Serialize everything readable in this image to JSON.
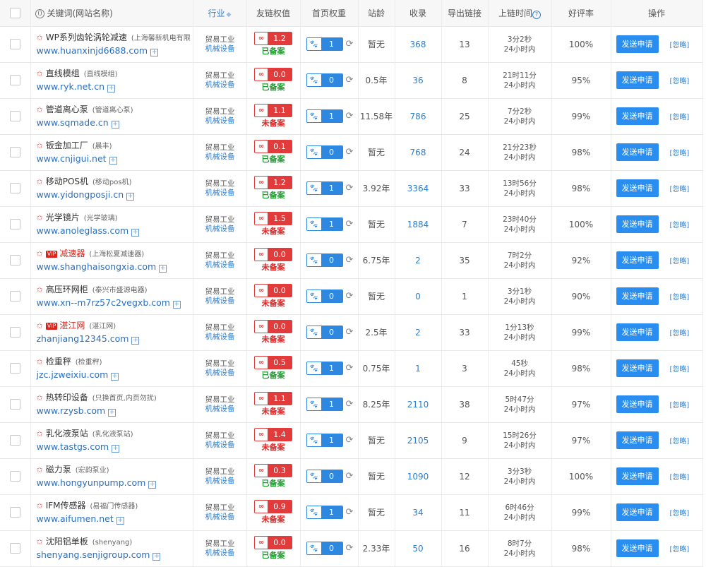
{
  "header": {
    "keyword": "关键词(网站名称)",
    "industry": "行业",
    "link_weight": "友链权值",
    "home_weight": "首页权重",
    "age": "站龄",
    "indexed": "收录",
    "outbound": "导出链接",
    "online_time": "上链时间",
    "rating": "好评率",
    "action": "操作",
    "sort_arrow": "◆",
    "help": "?"
  },
  "labels": {
    "send": "发送申请",
    "ignore": "[忽略]",
    "refresh": "⟳"
  },
  "rows": [
    {
      "flag": "✩",
      "vip": "",
      "name": "WP系列齿轮涡轮减速",
      "sub": "(上海馨新机电有限",
      "url": "www.huanxinjd6688.com",
      "ind1": "贸易工业",
      "ind2": "机械设备",
      "link": "1.2",
      "rec": "已备案",
      "rec_ok": true,
      "bd": "1",
      "age": "暂无",
      "indexed": "368",
      "out": "13",
      "t1": "3分2秒",
      "t2": "24小时内",
      "rate": "100%"
    },
    {
      "flag": "✩",
      "vip": "",
      "name": "直线模组",
      "sub": "(直线模组)",
      "url": "www.ryk.net.cn",
      "ind1": "贸易工业",
      "ind2": "机械设备",
      "link": "0.0",
      "rec": "已备案",
      "rec_ok": true,
      "bd": "0",
      "age": "0.5年",
      "indexed": "36",
      "out": "8",
      "t1": "21时11分",
      "t2": "24小时内",
      "rate": "95%"
    },
    {
      "flag": "✩",
      "vip": "",
      "name": "管道离心泵",
      "sub": "(管道离心泵)",
      "url": "www.sqmade.cn",
      "ind1": "贸易工业",
      "ind2": "机械设备",
      "link": "1.1",
      "rec": "未备案",
      "rec_ok": false,
      "bd": "1",
      "age": "11.58年",
      "indexed": "786",
      "out": "25",
      "t1": "7分2秒",
      "t2": "24小时内",
      "rate": "99%"
    },
    {
      "flag": "✩",
      "vip": "",
      "name": "钣金加工厂",
      "sub": "(晨丰)",
      "url": "www.cnjigui.net",
      "ind1": "贸易工业",
      "ind2": "机械设备",
      "link": "0.1",
      "rec": "已备案",
      "rec_ok": true,
      "bd": "0",
      "age": "暂无",
      "indexed": "768",
      "out": "24",
      "t1": "21分23秒",
      "t2": "24小时内",
      "rate": "98%"
    },
    {
      "flag": "✩",
      "vip": "",
      "name": "移动POS机",
      "sub": "(移动pos机)",
      "url": "www.yidongposji.cn",
      "ind1": "贸易工业",
      "ind2": "机械设备",
      "link": "1.2",
      "rec": "已备案",
      "rec_ok": true,
      "bd": "1",
      "age": "3.92年",
      "indexed": "3364",
      "out": "33",
      "t1": "13时56分",
      "t2": "24小时内",
      "rate": "98%"
    },
    {
      "flag": "✩",
      "vip": "",
      "name": "光学镜片",
      "sub": "(光学玻璃)",
      "url": "www.anoleglass.com",
      "ind1": "贸易工业",
      "ind2": "机械设备",
      "link": "1.5",
      "rec": "未备案",
      "rec_ok": false,
      "bd": "1",
      "age": "暂无",
      "indexed": "1884",
      "out": "7",
      "t1": "23时40分",
      "t2": "24小时内",
      "rate": "100%"
    },
    {
      "flag": "✩",
      "vip": "VIP",
      "name": "减速器",
      "sub": "(上海松夏减速器)",
      "url": "www.shanghaisongxia.com",
      "ind1": "贸易工业",
      "ind2": "机械设备",
      "link": "0.0",
      "rec": "未备案",
      "rec_ok": false,
      "bd": "0",
      "age": "6.75年",
      "indexed": "2",
      "out": "35",
      "t1": "7时2分",
      "t2": "24小时内",
      "rate": "92%"
    },
    {
      "flag": "✩",
      "vip": "",
      "name": "高压环网柜",
      "sub": "(泰兴市盛源电器)",
      "url": "www.xn--m7rz57c2vegxb.com",
      "ind1": "贸易工业",
      "ind2": "机械设备",
      "link": "0.0",
      "rec": "未备案",
      "rec_ok": false,
      "bd": "0",
      "age": "暂无",
      "indexed": "0",
      "out": "1",
      "t1": "3分1秒",
      "t2": "24小时内",
      "rate": "90%"
    },
    {
      "flag": "✩",
      "vip": "VIP",
      "name": "湛江网",
      "sub": "(湛江网)",
      "url": "zhanjiang12345.com",
      "ind1": "贸易工业",
      "ind2": "机械设备",
      "link": "0.0",
      "rec": "未备案",
      "rec_ok": false,
      "bd": "0",
      "age": "2.5年",
      "indexed": "2",
      "out": "33",
      "t1": "1分13秒",
      "t2": "24小时内",
      "rate": "99%"
    },
    {
      "flag": "✩",
      "vip": "",
      "name": "检重秤",
      "sub": "(检重秤)",
      "url": "jzc.jzweixiu.com",
      "ind1": "贸易工业",
      "ind2": "机械设备",
      "link": "0.5",
      "rec": "已备案",
      "rec_ok": true,
      "bd": "1",
      "age": "0.75年",
      "indexed": "1",
      "out": "3",
      "t1": "45秒",
      "t2": "24小时内",
      "rate": "98%"
    },
    {
      "flag": "✩",
      "vip": "",
      "name": "热转印设备",
      "sub": "(只换首页,内页勿扰)",
      "url": "www.rzysb.com",
      "ind1": "贸易工业",
      "ind2": "机械设备",
      "link": "1.1",
      "rec": "未备案",
      "rec_ok": false,
      "bd": "1",
      "age": "8.25年",
      "indexed": "2110",
      "out": "38",
      "t1": "5时47分",
      "t2": "24小时内",
      "rate": "97%"
    },
    {
      "flag": "✩",
      "vip": "",
      "name": "乳化液泵站",
      "sub": "(乳化液泵站)",
      "url": "www.tastgs.com",
      "ind1": "贸易工业",
      "ind2": "机械设备",
      "link": "1.4",
      "rec": "未备案",
      "rec_ok": false,
      "bd": "1",
      "age": "暂无",
      "indexed": "2105",
      "out": "9",
      "t1": "15时26分",
      "t2": "24小时内",
      "rate": "97%"
    },
    {
      "flag": "✩",
      "vip": "",
      "name": "磁力泵",
      "sub": "(宏韵泵业)",
      "url": "www.hongyunpump.com",
      "ind1": "贸易工业",
      "ind2": "机械设备",
      "link": "0.3",
      "rec": "已备案",
      "rec_ok": true,
      "bd": "0",
      "age": "暂无",
      "indexed": "1090",
      "out": "12",
      "t1": "3分3秒",
      "t2": "24小时内",
      "rate": "100%"
    },
    {
      "flag": "✩",
      "vip": "",
      "name": "IFM传感器",
      "sub": "(易福门传感器)",
      "url": "www.aifumen.net",
      "ind1": "贸易工业",
      "ind2": "机械设备",
      "link": "0.9",
      "rec": "未备案",
      "rec_ok": false,
      "bd": "1",
      "age": "暂无",
      "indexed": "34",
      "out": "11",
      "t1": "6时46分",
      "t2": "24小时内",
      "rate": "99%"
    },
    {
      "flag": "✩",
      "vip": "",
      "name": "沈阳铝单板",
      "sub": "(shenyang)",
      "url": "shenyang.senjigroup.com",
      "ind1": "贸易工业",
      "ind2": "机械设备",
      "link": "0.0",
      "rec": "已备案",
      "rec_ok": true,
      "bd": "0",
      "age": "2.33年",
      "indexed": "50",
      "out": "16",
      "t1": "8时7分",
      "t2": "24小时内",
      "rate": "98%"
    }
  ],
  "colors": {
    "accent": "#2a8ef0",
    "link_red": "#e23b3b",
    "ok_green": "#1f9a2e"
  }
}
